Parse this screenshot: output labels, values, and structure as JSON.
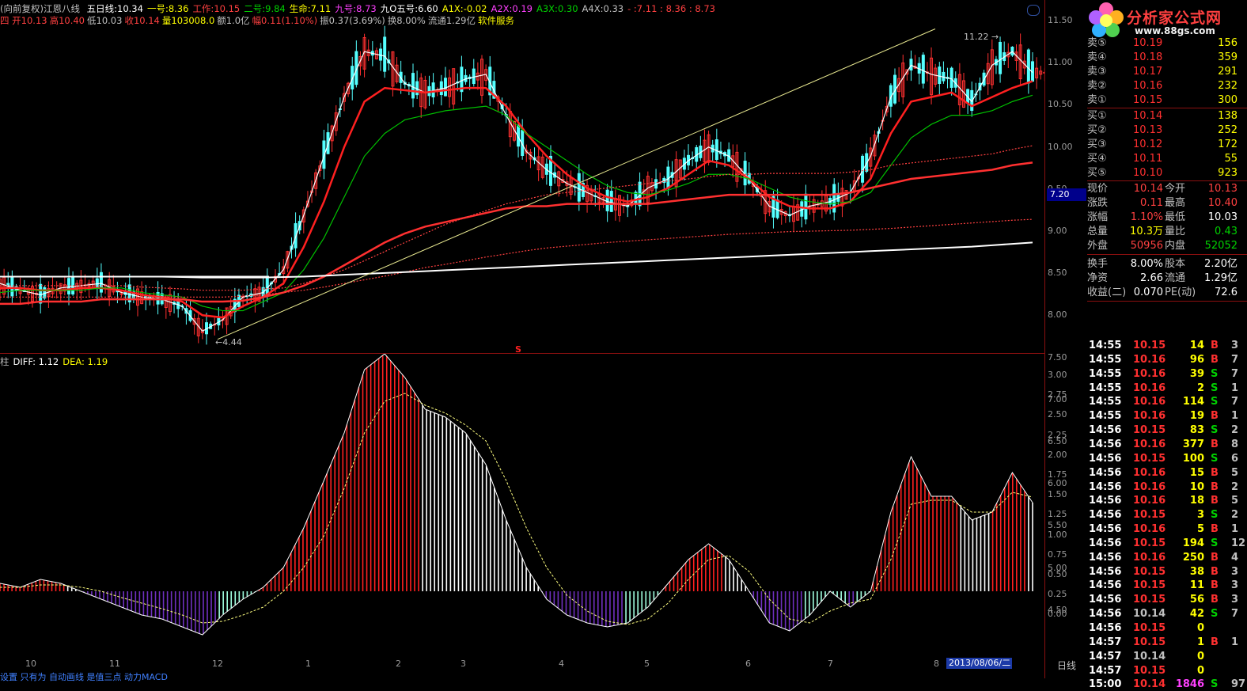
{
  "header1": {
    "prefix": "(向前复权)",
    "title": "江恩八线",
    "items": [
      {
        "label": "五日线:",
        "value": "10.34",
        "color": "#ffffff"
      },
      {
        "label": "一号:",
        "value": "8.36",
        "color": "#ffff00"
      },
      {
        "label": "工作:",
        "value": "10.15",
        "color": "#ff4040"
      },
      {
        "label": "二号:",
        "value": "9.84",
        "color": "#00d000"
      },
      {
        "label": "生命:",
        "value": "7.11",
        "color": "#ffff00"
      },
      {
        "label": "九号:",
        "value": "8.73",
        "color": "#ff40ff"
      },
      {
        "label": "九O五号:",
        "value": "6.60",
        "color": "#ffffff"
      },
      {
        "label": "A1X:",
        "value": "-0.02",
        "color": "#ffff00"
      },
      {
        "label": "A2X:",
        "value": "0.19",
        "color": "#ff40ff"
      },
      {
        "label": "A3X:",
        "value": "0.30",
        "color": "#00d000"
      },
      {
        "label": "A4X:",
        "value": "0.33",
        "color": "#c0c0c0"
      },
      {
        "label": "- :",
        "value": "7.11 : 8.36 : 8.73",
        "color": "#ff4040"
      }
    ]
  },
  "header2": {
    "items": [
      {
        "text": "四 开10.13",
        "color": "#ff4040"
      },
      {
        "text": "高10.40",
        "color": "#ff4040"
      },
      {
        "text": "低10.03",
        "color": "#c0c0c0"
      },
      {
        "text": "收10.14",
        "color": "#ff4040"
      },
      {
        "text": "量103008.0",
        "color": "#ffff00"
      },
      {
        "text": "额1.0亿",
        "color": "#c0c0c0"
      },
      {
        "text": "幅0.11(1.10%)",
        "color": "#ff4040"
      },
      {
        "text": "振0.37(3.69%)",
        "color": "#c0c0c0"
      },
      {
        "text": "换8.00%",
        "color": "#c0c0c0"
      },
      {
        "text": "流通1.29亿",
        "color": "#c0c0c0"
      },
      {
        "text": "软件服务",
        "color": "#ffff00"
      }
    ]
  },
  "macd_header": {
    "name": "柱",
    "diff": "DIFF: 1.12",
    "dea": "DEA: 1.19"
  },
  "annotations": {
    "high": "11.22",
    "low": "4.44",
    "s_mark": "S",
    "price_box": "7.20"
  },
  "price_axis": [
    "11.50",
    "11.00",
    "10.50",
    "10.00",
    "9.50",
    "9.00",
    "8.50",
    "8.00",
    "7.50",
    "7.00",
    "6.50",
    "6.00",
    "5.50",
    "5.00",
    "4.50"
  ],
  "macd_axis": [
    "3.00",
    "2.75",
    "2.50",
    "2.25",
    "2.00",
    "1.75",
    "1.50",
    "1.25",
    "1.00",
    "0.75",
    "0.50",
    "0.25",
    "0.00"
  ],
  "x_axis": [
    "10",
    "11",
    "12",
    "1",
    "2",
    "3",
    "4",
    "5",
    "6",
    "7",
    "8"
  ],
  "date_label": "2013/08/06/二",
  "period_label": "日线",
  "bottom_text": "设置 只有为 自动画线 是值三点 动力MACD",
  "logo": {
    "name": "分析家公式网",
    "url": "www.88gs.com"
  },
  "orderbook": {
    "asks": [
      {
        "label": "卖⑤",
        "price": "10.19",
        "vol": "156"
      },
      {
        "label": "卖④",
        "price": "10.18",
        "vol": "359"
      },
      {
        "label": "卖③",
        "price": "10.17",
        "vol": "291"
      },
      {
        "label": "卖②",
        "price": "10.16",
        "vol": "232"
      },
      {
        "label": "卖①",
        "price": "10.15",
        "vol": "300"
      }
    ],
    "bids": [
      {
        "label": "买①",
        "price": "10.14",
        "vol": "138"
      },
      {
        "label": "买②",
        "price": "10.13",
        "vol": "252"
      },
      {
        "label": "买③",
        "price": "10.12",
        "vol": "172"
      },
      {
        "label": "买④",
        "price": "10.11",
        "vol": "55"
      },
      {
        "label": "买⑤",
        "price": "10.10",
        "vol": "923"
      }
    ]
  },
  "quote": [
    {
      "l1": "现价",
      "v1": "10.14",
      "c1": "#ff4040",
      "l2": "今开",
      "v2": "10.13",
      "c2": "#ff4040"
    },
    {
      "l1": "涨跌",
      "v1": "0.11",
      "c1": "#ff4040",
      "l2": "最高",
      "v2": "10.40",
      "c2": "#ff4040"
    },
    {
      "l1": "涨幅",
      "v1": "1.10%",
      "c1": "#ff4040",
      "l2": "最低",
      "v2": "10.03",
      "c2": "#ffffff"
    },
    {
      "l1": "总量",
      "v1": "10.3万",
      "c1": "#ffff00",
      "l2": "量比",
      "v2": "0.43",
      "c2": "#00d000"
    },
    {
      "l1": "外盘",
      "v1": "50956",
      "c1": "#ff4040",
      "l2": "内盘",
      "v2": "52052",
      "c2": "#00d000"
    }
  ],
  "fundamentals": [
    {
      "l1": "换手",
      "v1": "8.00%",
      "l2": "股本",
      "v2": "2.20亿"
    },
    {
      "l1": "净资",
      "v1": "2.66",
      "l2": "流通",
      "v2": "1.29亿"
    },
    {
      "l1": "收益(二)",
      "v1": "0.070",
      "l2": "PE(动)",
      "v2": "72.6"
    }
  ],
  "ticks": [
    {
      "t": "14:55",
      "p": "10.15",
      "v": "14",
      "d": "B",
      "n": "3"
    },
    {
      "t": "14:55",
      "p": "10.16",
      "v": "96",
      "d": "B",
      "n": "7"
    },
    {
      "t": "14:55",
      "p": "10.16",
      "v": "39",
      "d": "S",
      "n": "7"
    },
    {
      "t": "14:55",
      "p": "10.16",
      "v": "2",
      "d": "S",
      "n": "1"
    },
    {
      "t": "14:55",
      "p": "10.16",
      "v": "114",
      "d": "S",
      "n": "7"
    },
    {
      "t": "14:55",
      "p": "10.16",
      "v": "19",
      "d": "B",
      "n": "1"
    },
    {
      "t": "14:56",
      "p": "10.15",
      "v": "83",
      "d": "S",
      "n": "2"
    },
    {
      "t": "14:56",
      "p": "10.16",
      "v": "377",
      "d": "B",
      "n": "8"
    },
    {
      "t": "14:56",
      "p": "10.15",
      "v": "100",
      "d": "S",
      "n": "6"
    },
    {
      "t": "14:56",
      "p": "10.16",
      "v": "15",
      "d": "B",
      "n": "5"
    },
    {
      "t": "14:56",
      "p": "10.16",
      "v": "10",
      "d": "B",
      "n": "2"
    },
    {
      "t": "14:56",
      "p": "10.16",
      "v": "18",
      "d": "B",
      "n": "5"
    },
    {
      "t": "14:56",
      "p": "10.15",
      "v": "3",
      "d": "S",
      "n": "2"
    },
    {
      "t": "14:56",
      "p": "10.16",
      "v": "5",
      "d": "B",
      "n": "1"
    },
    {
      "t": "14:56",
      "p": "10.15",
      "v": "194",
      "d": "S",
      "n": "12"
    },
    {
      "t": "14:56",
      "p": "10.16",
      "v": "250",
      "d": "B",
      "n": "4"
    },
    {
      "t": "14:56",
      "p": "10.15",
      "v": "38",
      "d": "B",
      "n": "3"
    },
    {
      "t": "14:56",
      "p": "10.15",
      "v": "11",
      "d": "B",
      "n": "3"
    },
    {
      "t": "14:56",
      "p": "10.15",
      "v": "56",
      "d": "B",
      "n": "3"
    },
    {
      "t": "14:56",
      "p": "10.14",
      "v": "42",
      "d": "S",
      "n": "7"
    },
    {
      "t": "14:56",
      "p": "10.15",
      "v": "0",
      "d": "",
      "n": ""
    },
    {
      "t": "14:57",
      "p": "10.15",
      "v": "1",
      "d": "B",
      "n": "1"
    },
    {
      "t": "14:57",
      "p": "10.14",
      "v": "0",
      "d": "",
      "n": ""
    },
    {
      "t": "14:57",
      "p": "10.15",
      "v": "0",
      "d": "",
      "n": ""
    },
    {
      "t": "15:00",
      "p": "10.14",
      "v": "1846",
      "d": "S",
      "n": "97"
    }
  ],
  "chart_data": {
    "type": "line",
    "title": "江恩八线",
    "price_ylim": [
      4.25,
      11.75
    ],
    "macd_ylim": [
      -0.75,
      3.05
    ],
    "x_months": [
      "10",
      "11",
      "12",
      "1",
      "2",
      "3",
      "4",
      "5",
      "6",
      "7",
      "8"
    ],
    "series": [
      {
        "name": "五日线",
        "color": "#ffffff",
        "values": [
          5.7,
          5.55,
          5.45,
          5.6,
          5.65,
          5.7,
          5.5,
          5.4,
          5.35,
          5.2,
          4.65,
          4.9,
          5.4,
          5.5,
          6.0,
          7.2,
          8.5,
          9.8,
          10.8,
          10.7,
          10.1,
          9.9,
          10.0,
          10.2,
          10.3,
          9.4,
          8.6,
          8.2,
          7.9,
          7.7,
          7.5,
          7.4,
          7.8,
          8.0,
          8.4,
          8.7,
          8.5,
          8.0,
          7.4,
          7.2,
          7.4,
          7.5,
          7.7,
          8.5,
          9.8,
          10.5,
          10.3,
          10.2,
          9.7,
          10.5,
          10.8,
          10.34
        ]
      },
      {
        "name": "工作",
        "color": "#ff2020",
        "values": [
          5.6,
          5.6,
          5.55,
          5.55,
          5.6,
          5.6,
          5.55,
          5.45,
          5.4,
          5.3,
          5.0,
          4.95,
          5.2,
          5.4,
          5.7,
          6.5,
          7.5,
          8.7,
          9.7,
          10.0,
          9.95,
          9.9,
          9.95,
          10.0,
          10.0,
          9.6,
          9.0,
          8.5,
          8.1,
          7.8,
          7.6,
          7.5,
          7.6,
          7.8,
          8.1,
          8.4,
          8.3,
          8.0,
          7.6,
          7.4,
          7.35,
          7.35,
          7.5,
          8.0,
          9.0,
          9.7,
          9.8,
          9.9,
          9.6,
          9.8,
          10.0,
          10.15
        ]
      },
      {
        "name": "二号",
        "color": "#00c000",
        "values": [
          5.5,
          5.55,
          5.55,
          5.55,
          5.55,
          5.6,
          5.6,
          5.5,
          5.45,
          5.4,
          5.2,
          5.1,
          5.1,
          5.3,
          5.5,
          6.0,
          6.7,
          7.6,
          8.5,
          9.0,
          9.3,
          9.4,
          9.5,
          9.55,
          9.6,
          9.4,
          9.0,
          8.7,
          8.4,
          8.1,
          7.85,
          7.7,
          7.65,
          7.75,
          7.9,
          8.1,
          8.1,
          8.0,
          7.8,
          7.6,
          7.5,
          7.45,
          7.5,
          7.7,
          8.3,
          8.9,
          9.2,
          9.4,
          9.4,
          9.5,
          9.7,
          9.84
        ]
      },
      {
        "name": "一号",
        "color": "#ff3030",
        "values": [
          5.25,
          5.25,
          5.3,
          5.3,
          5.3,
          5.35,
          5.35,
          5.35,
          5.35,
          5.35,
          5.3,
          5.3,
          5.32,
          5.4,
          5.5,
          5.65,
          5.85,
          6.1,
          6.35,
          6.6,
          6.8,
          6.95,
          7.05,
          7.15,
          7.25,
          7.35,
          7.4,
          7.4,
          7.45,
          7.45,
          7.45,
          7.45,
          7.45,
          7.5,
          7.55,
          7.6,
          7.65,
          7.65,
          7.65,
          7.65,
          7.65,
          7.65,
          7.7,
          7.8,
          7.9,
          8.0,
          8.05,
          8.1,
          8.15,
          8.2,
          8.3,
          8.36
        ]
      },
      {
        "name": "九号",
        "color": "#ff4040",
        "values": [
          5.65,
          5.65,
          5.65,
          5.65,
          5.65,
          5.65,
          5.65,
          5.62,
          5.6,
          5.58,
          5.55,
          5.55,
          5.55,
          5.58,
          5.6,
          5.7,
          5.85,
          6.0,
          6.2,
          6.4,
          6.6,
          6.8,
          7.0,
          7.15,
          7.3,
          7.45,
          7.55,
          7.65,
          7.7,
          7.75,
          7.8,
          7.85,
          7.9,
          7.95,
          8.0,
          8.05,
          8.1,
          8.1,
          8.12,
          8.12,
          8.12,
          8.12,
          8.15,
          8.2,
          8.3,
          8.35,
          8.4,
          8.45,
          8.5,
          8.55,
          8.65,
          8.73
        ]
      },
      {
        "name": "生命",
        "color": "#ff4040",
        "values": [
          5.4,
          5.4,
          5.4,
          5.4,
          5.4,
          5.4,
          5.4,
          5.4,
          5.4,
          5.4,
          5.4,
          5.4,
          5.42,
          5.45,
          5.5,
          5.55,
          5.62,
          5.7,
          5.78,
          5.86,
          5.95,
          6.05,
          6.12,
          6.2,
          6.28,
          6.35,
          6.42,
          6.48,
          6.52,
          6.56,
          6.6,
          6.63,
          6.66,
          6.69,
          6.72,
          6.75,
          6.78,
          6.8,
          6.82,
          6.84,
          6.85,
          6.86,
          6.87,
          6.89,
          6.91,
          6.94,
          6.97,
          7.0,
          7.03,
          7.06,
          7.09,
          7.11
        ]
      },
      {
        "name": "九O五号",
        "color": "#ffffff",
        "values": [
          5.85,
          5.85,
          5.85,
          5.85,
          5.85,
          5.85,
          5.85,
          5.85,
          5.85,
          5.84,
          5.83,
          5.83,
          5.83,
          5.83,
          5.84,
          5.85,
          5.87,
          5.89,
          5.91,
          5.93,
          5.95,
          5.97,
          5.99,
          6.01,
          6.03,
          6.05,
          6.07,
          6.09,
          6.11,
          6.13,
          6.15,
          6.17,
          6.19,
          6.21,
          6.23,
          6.25,
          6.27,
          6.29,
          6.31,
          6.33,
          6.35,
          6.37,
          6.39,
          6.41,
          6.43,
          6.45,
          6.47,
          6.49,
          6.51,
          6.54,
          6.57,
          6.6
        ]
      }
    ],
    "macd_diff": [
      0.1,
      0.05,
      0.15,
      0.1,
      0.0,
      -0.1,
      -0.2,
      -0.3,
      -0.35,
      -0.45,
      -0.55,
      -0.3,
      -0.1,
      0.05,
      0.3,
      0.8,
      1.4,
      2.0,
      2.8,
      3.0,
      2.7,
      2.3,
      2.2,
      2.0,
      1.6,
      0.9,
      0.3,
      -0.1,
      -0.3,
      -0.4,
      -0.45,
      -0.4,
      -0.2,
      0.1,
      0.4,
      0.6,
      0.4,
      0.0,
      -0.4,
      -0.5,
      -0.3,
      0.0,
      -0.2,
      0.0,
      1.0,
      1.7,
      1.2,
      1.2,
      0.9,
      1.0,
      1.5,
      1.12
    ],
    "macd_dea": [
      0.05,
      0.05,
      0.08,
      0.08,
      0.05,
      0.0,
      -0.08,
      -0.15,
      -0.22,
      -0.3,
      -0.4,
      -0.38,
      -0.3,
      -0.2,
      0.0,
      0.3,
      0.7,
      1.3,
      2.0,
      2.4,
      2.5,
      2.35,
      2.25,
      2.1,
      1.9,
      1.4,
      0.8,
      0.3,
      -0.05,
      -0.25,
      -0.38,
      -0.42,
      -0.35,
      -0.15,
      0.15,
      0.4,
      0.45,
      0.25,
      -0.1,
      -0.35,
      -0.4,
      -0.25,
      -0.15,
      -0.1,
      0.4,
      1.1,
      1.15,
      1.15,
      1.0,
      1.0,
      1.25,
      1.19
    ]
  }
}
